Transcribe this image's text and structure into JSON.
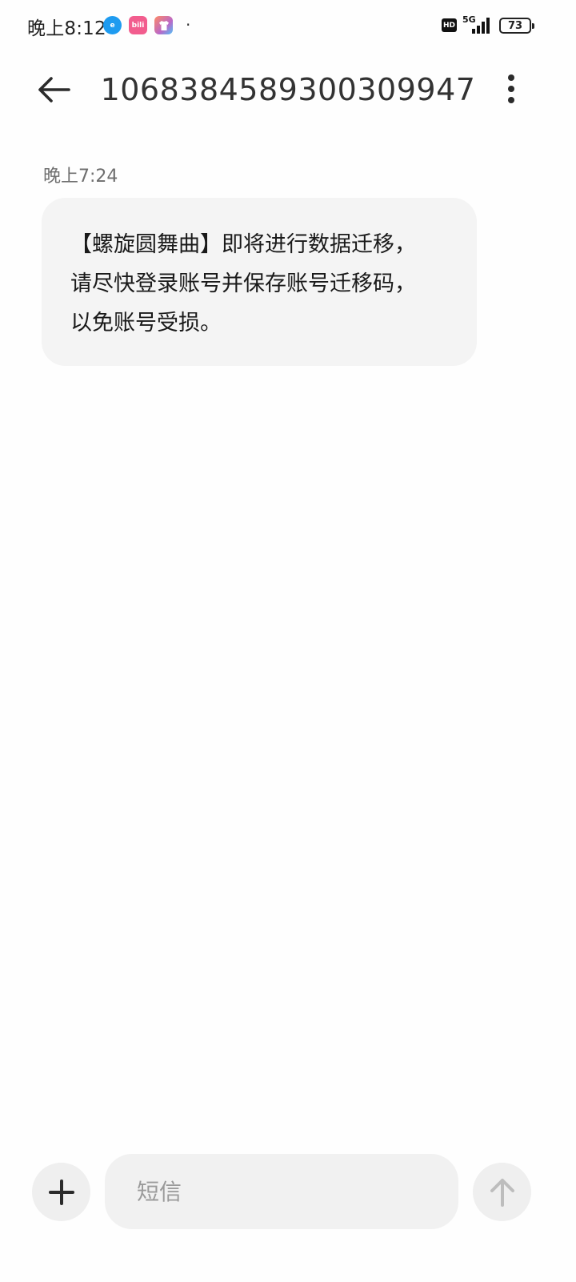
{
  "status_bar": {
    "time": "晚上8:12",
    "app_icons": [
      "eleme-icon",
      "bilibili-icon",
      "theme-shirt-icon"
    ],
    "hd_label": "HD",
    "network_label": "5G",
    "battery_level": "73"
  },
  "header": {
    "contact": "1068384589300309947"
  },
  "conversation": {
    "messages": [
      {
        "timestamp": "晚上7:24",
        "lines": [
          "【螺旋圆舞曲】即将进行数据迁移，",
          "请尽快登录账号并保存账号迁移码，",
          "以免账号受损。"
        ]
      }
    ]
  },
  "composer": {
    "placeholder": "短信",
    "value": ""
  },
  "colors": {
    "bubble_bg": "#f4f4f4",
    "button_bg": "#efefef",
    "icon_dark": "#2b2b2b",
    "send_icon": "#bdbdbd"
  }
}
